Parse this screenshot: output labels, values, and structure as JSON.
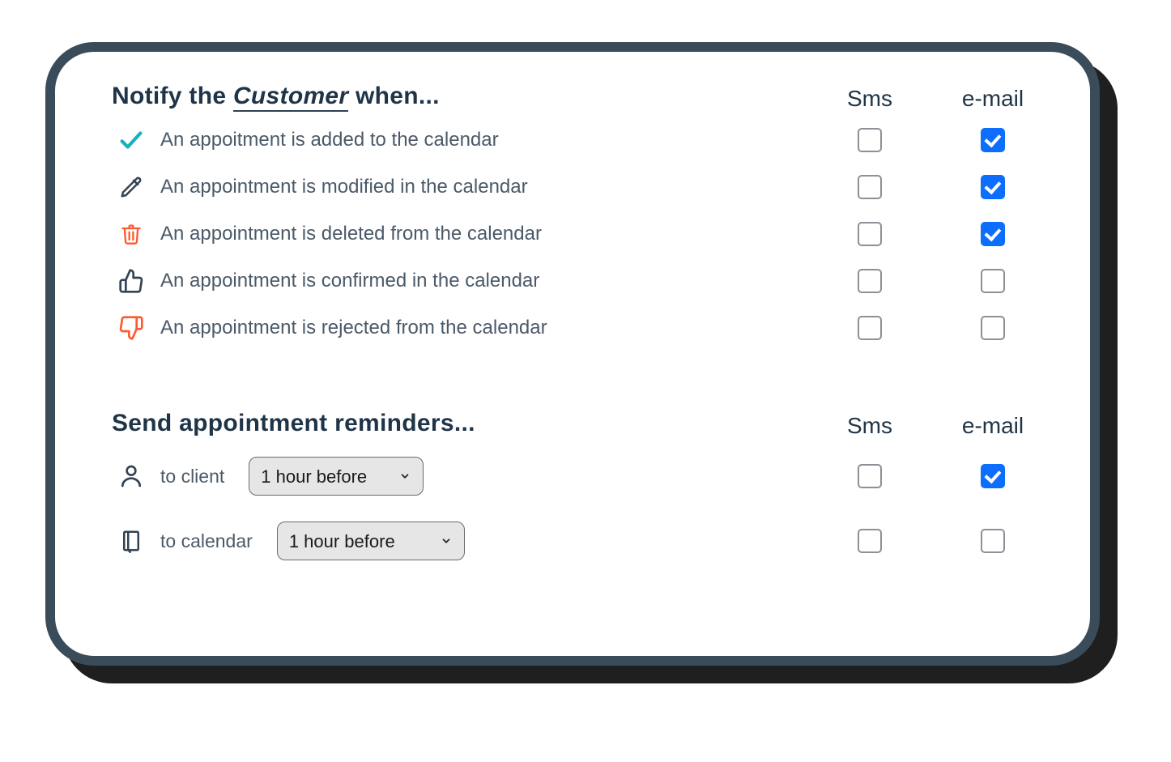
{
  "notify": {
    "title_prefix": "Notify the ",
    "title_emphasis": "Customer",
    "title_suffix": " when...",
    "columns": {
      "sms": "Sms",
      "email": "e-mail"
    },
    "rows": [
      {
        "icon": "check",
        "label": "An appoitment is added to the calendar",
        "sms": false,
        "email": true
      },
      {
        "icon": "pencil",
        "label": "An appointment is modified in the calendar",
        "sms": false,
        "email": true
      },
      {
        "icon": "trash",
        "label": "An appointment is deleted from the calendar",
        "sms": false,
        "email": true
      },
      {
        "icon": "thumbs-up",
        "label": "An appointment is confirmed in the calendar",
        "sms": false,
        "email": false
      },
      {
        "icon": "thumbs-down",
        "label": "An appointment is rejected from the calendar",
        "sms": false,
        "email": false
      }
    ]
  },
  "reminders": {
    "title": "Send appointment reminders...",
    "columns": {
      "sms": "Sms",
      "email": "e-mail"
    },
    "rows": [
      {
        "icon": "person",
        "label": "to client",
        "select": "1 hour before",
        "options": [
          "1 hour before"
        ],
        "sms": false,
        "email": true
      },
      {
        "icon": "notebook",
        "label": "to calendar",
        "select": "1 hour before",
        "options": [
          "1 hour before"
        ],
        "sms": false,
        "email": false
      }
    ]
  }
}
